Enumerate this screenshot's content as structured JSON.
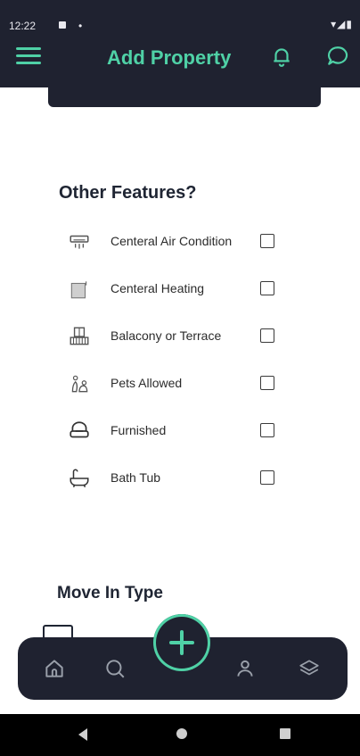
{
  "status_bar": {
    "time": "12:22",
    "dot": "•",
    "right": "▾◢▮"
  },
  "header": {
    "title": "Add Property"
  },
  "section": {
    "title": "Other Features?",
    "features": [
      {
        "label": "Centeral Air Condition",
        "icon": "air-conditioner-icon",
        "checked": false
      },
      {
        "label": "Centeral Heating",
        "icon": "heating-icon",
        "checked": false
      },
      {
        "label": "Balacony or Terrace",
        "icon": "balcony-icon",
        "checked": false
      },
      {
        "label": "Pets Allowed",
        "icon": "pets-icon",
        "checked": false
      },
      {
        "label": "Furnished",
        "icon": "sofa-icon",
        "checked": false
      },
      {
        "label": "Bath Tub",
        "icon": "bathtub-icon",
        "checked": false
      }
    ]
  },
  "move_in": {
    "title": "Move In Type"
  },
  "bottom_nav": {
    "items": [
      "home-icon",
      "search-icon",
      "add-icon",
      "profile-icon",
      "layers-icon"
    ]
  },
  "colors": {
    "accent": "#4fd1a6",
    "dark": "#1f2230"
  }
}
